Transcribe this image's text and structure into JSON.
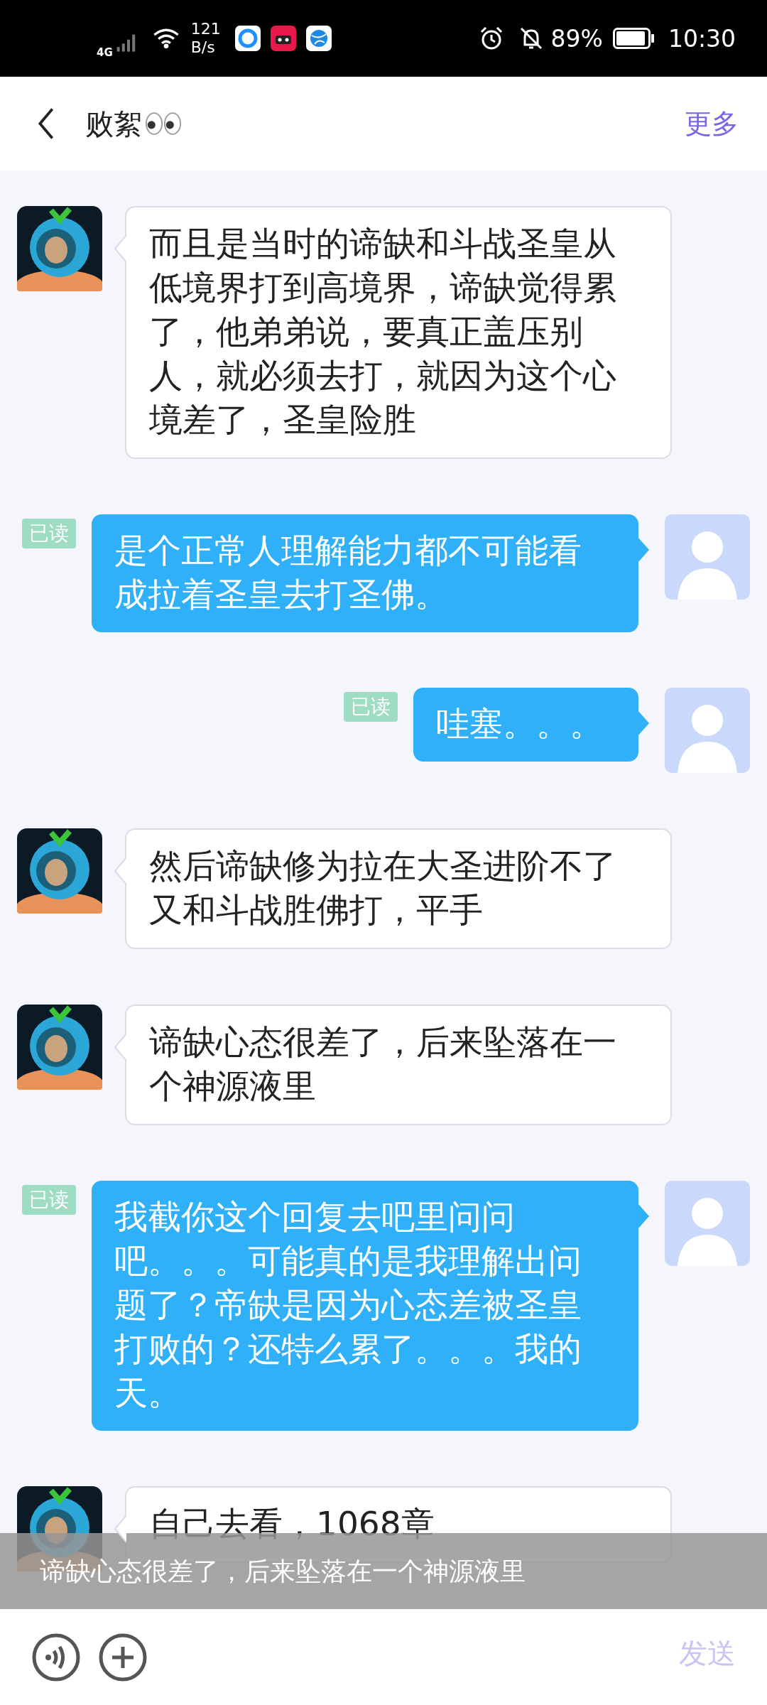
{
  "status_bar": {
    "network": "4G",
    "speed_value": "121",
    "speed_unit": "B/s",
    "battery": "89%",
    "time": "10:30"
  },
  "header": {
    "title": "败絮",
    "more": "更多"
  },
  "messages": [
    {
      "kind": "received",
      "text": "而且是当时的谛缺和斗战圣皇从低境界打到高境界，谛缺觉得累了，他弟弟说，要真正盖压别人，就必须去打，就因为这个心境差了，圣皇险胜"
    },
    {
      "kind": "sent",
      "read_label": "已读",
      "text": "是个正常人理解能力都不可能看成拉着圣皇去打圣佛。"
    },
    {
      "kind": "sent",
      "read_label": "已读",
      "text": "哇塞。。。"
    },
    {
      "kind": "received",
      "text": "然后谛缺修为拉在大圣进阶不了又和斗战胜佛打，平手"
    },
    {
      "kind": "received",
      "text": "谛缺心态很差了，后来坠落在一个神源液里"
    },
    {
      "kind": "sent",
      "read_label": "已读",
      "text": "我截你这个回复去吧里问问吧。。。可能真的是我理解出问题了？帝缺是因为心态差被圣皇打败的？还特么累了。。。我的天。"
    },
    {
      "kind": "received",
      "text": "自己去看，1068章"
    }
  ],
  "toast": "谛缺心态很差了，后来坠落在一个神源液里",
  "send_button": {
    "label": "发送",
    "disabled": true
  }
}
